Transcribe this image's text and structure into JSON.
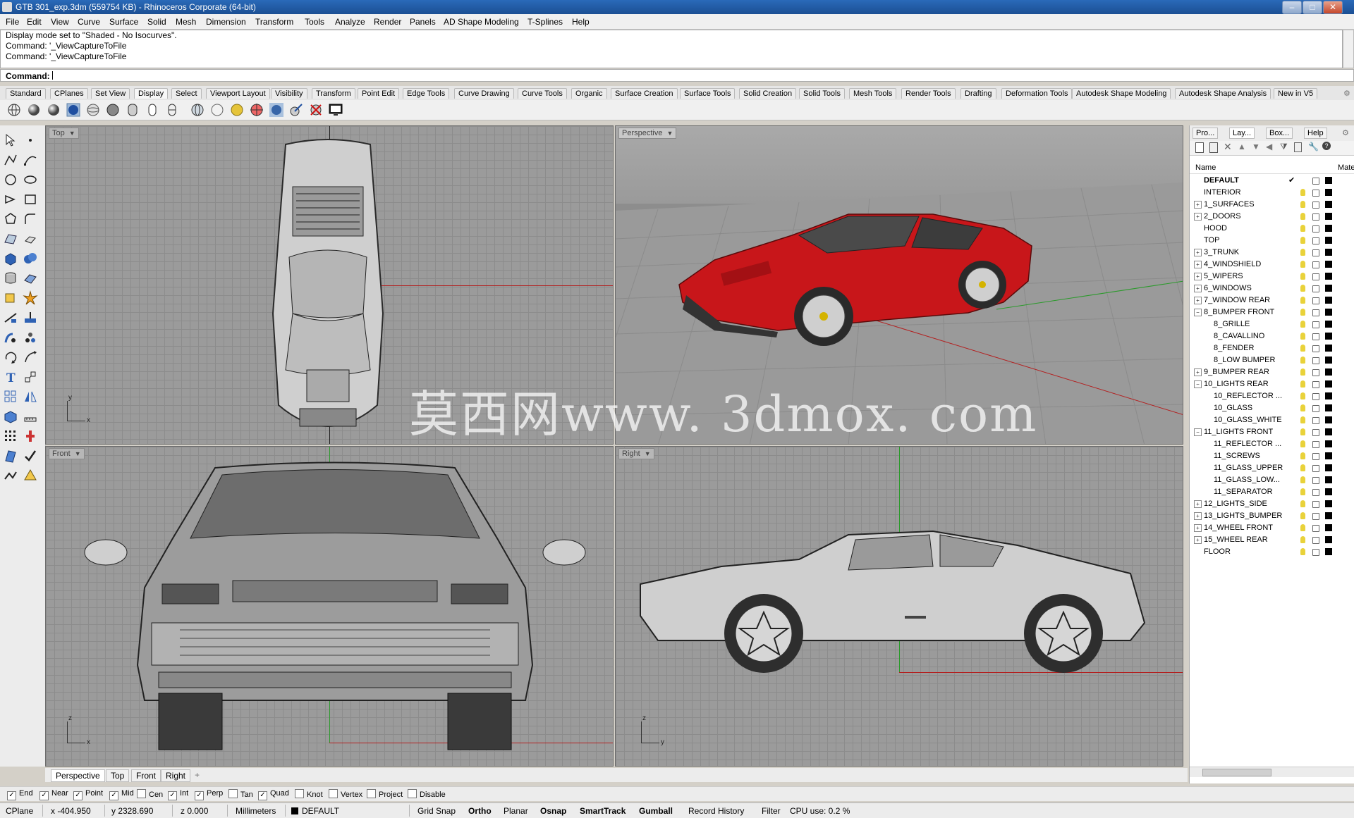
{
  "window": {
    "title": "GTB 301_exp.3dm (559754 KB) - Rhinoceros Corporate (64-bit)"
  },
  "menu": [
    "File",
    "Edit",
    "View",
    "Curve",
    "Surface",
    "Solid",
    "Mesh",
    "Dimension",
    "Transform",
    "Tools",
    "Analyze",
    "Render",
    "Panels",
    "AD Shape Modeling",
    "T-Splines",
    "Help"
  ],
  "command_history": [
    "Display mode set to \"Shaded - No Isocurves\".",
    "Command: '_ViewCaptureToFile",
    "Command: '_ViewCaptureToFile"
  ],
  "command_prompt": "Command:",
  "toolbar_tabs": [
    "Standard",
    "CPlanes",
    "Set View",
    "Display",
    "Select",
    "Viewport Layout",
    "Visibility",
    "Transform",
    "Point Edit",
    "Edge Tools",
    "Curve Drawing",
    "Curve Tools",
    "Organic",
    "Surface Creation",
    "Surface Tools",
    "Solid Creation",
    "Solid Tools",
    "Mesh Tools",
    "Render Tools",
    "Drafting",
    "Deformation Tools",
    "Autodesk Shape Modeling",
    "Autodesk Shape Analysis",
    "New in V5"
  ],
  "active_toolbar_tab": "Display",
  "viewports": {
    "top": "Top",
    "perspective": "Perspective",
    "front": "Front",
    "right": "Right"
  },
  "watermark": "莫西网www. 3dmox. com",
  "viewport_tabs": [
    "Perspective",
    "Top",
    "Front",
    "Right"
  ],
  "viewport_tab_add": "+",
  "osnaps": [
    {
      "label": "End",
      "checked": true
    },
    {
      "label": "Near",
      "checked": true
    },
    {
      "label": "Point",
      "checked": true
    },
    {
      "label": "Mid",
      "checked": true
    },
    {
      "label": "Cen",
      "checked": false
    },
    {
      "label": "Int",
      "checked": true
    },
    {
      "label": "Perp",
      "checked": true
    },
    {
      "label": "Tan",
      "checked": false
    },
    {
      "label": "Quad",
      "checked": true
    },
    {
      "label": "Knot",
      "checked": false
    },
    {
      "label": "Vertex",
      "checked": false
    },
    {
      "label": "Project",
      "checked": false
    },
    {
      "label": "Disable",
      "checked": false
    }
  ],
  "status": {
    "cplane": "CPlane",
    "x": "x -404.950",
    "y": "y 2328.690",
    "z": "z 0.000",
    "units": "Millimeters",
    "layer": "DEFAULT",
    "grid_snap": "Grid Snap",
    "ortho": "Ortho",
    "planar": "Planar",
    "osnap": "Osnap",
    "smarttrack": "SmartTrack",
    "gumball": "Gumball",
    "record_history": "Record History",
    "filter": "Filter",
    "cpu": "CPU use: 0.2 %"
  },
  "panel": {
    "tabs": [
      "Pro...",
      "Lay...",
      "Box...",
      "Help"
    ],
    "col_name": "Name",
    "col_material": "Mate",
    "layers": [
      {
        "name": "DEFAULT",
        "level": 0,
        "expander": "",
        "current": true
      },
      {
        "name": "INTERIOR",
        "level": 0,
        "expander": ""
      },
      {
        "name": "1_SURFACES",
        "level": 0,
        "expander": "+"
      },
      {
        "name": "2_DOORS",
        "level": 0,
        "expander": "+"
      },
      {
        "name": "HOOD",
        "level": 0,
        "expander": ""
      },
      {
        "name": "TOP",
        "level": 0,
        "expander": ""
      },
      {
        "name": "3_TRUNK",
        "level": 0,
        "expander": "+"
      },
      {
        "name": "4_WINDSHIELD",
        "level": 0,
        "expander": "+"
      },
      {
        "name": "5_WIPERS",
        "level": 0,
        "expander": "+"
      },
      {
        "name": "6_WINDOWS",
        "level": 0,
        "expander": "+"
      },
      {
        "name": "7_WINDOW REAR",
        "level": 0,
        "expander": "+"
      },
      {
        "name": "8_BUMPER FRONT",
        "level": 0,
        "expander": "-"
      },
      {
        "name": "8_GRILLE",
        "level": 1,
        "expander": ""
      },
      {
        "name": "8_CAVALLINO",
        "level": 1,
        "expander": ""
      },
      {
        "name": "8_FENDER",
        "level": 1,
        "expander": ""
      },
      {
        "name": "8_LOW BUMPER",
        "level": 1,
        "expander": ""
      },
      {
        "name": "9_BUMPER REAR",
        "level": 0,
        "expander": "+"
      },
      {
        "name": "10_LIGHTS REAR",
        "level": 0,
        "expander": "-"
      },
      {
        "name": "10_REFLECTOR ...",
        "level": 1,
        "expander": ""
      },
      {
        "name": "10_GLASS",
        "level": 1,
        "expander": ""
      },
      {
        "name": "10_GLASS_WHITE",
        "level": 1,
        "expander": ""
      },
      {
        "name": "11_LIGHTS FRONT",
        "level": 0,
        "expander": "-"
      },
      {
        "name": "11_REFLECTOR ...",
        "level": 1,
        "expander": ""
      },
      {
        "name": "11_SCREWS",
        "level": 1,
        "expander": ""
      },
      {
        "name": "11_GLASS_UPPER",
        "level": 1,
        "expander": ""
      },
      {
        "name": "11_GLASS_LOW...",
        "level": 1,
        "expander": ""
      },
      {
        "name": "11_SEPARATOR",
        "level": 1,
        "expander": ""
      },
      {
        "name": "12_LIGHTS_SIDE",
        "level": 0,
        "expander": "+"
      },
      {
        "name": "13_LIGHTS_BUMPER",
        "level": 0,
        "expander": "+"
      },
      {
        "name": "14_WHEEL FRONT",
        "level": 0,
        "expander": "+"
      },
      {
        "name": "15_WHEEL REAR",
        "level": 0,
        "expander": "+"
      },
      {
        "name": "FLOOR",
        "level": 0,
        "expander": ""
      }
    ]
  },
  "colors": {
    "car_red": "#c8161a",
    "axis_x": "#b32020",
    "axis_y": "#2b9a2b",
    "viewport_bg": "#9b9b9b"
  }
}
